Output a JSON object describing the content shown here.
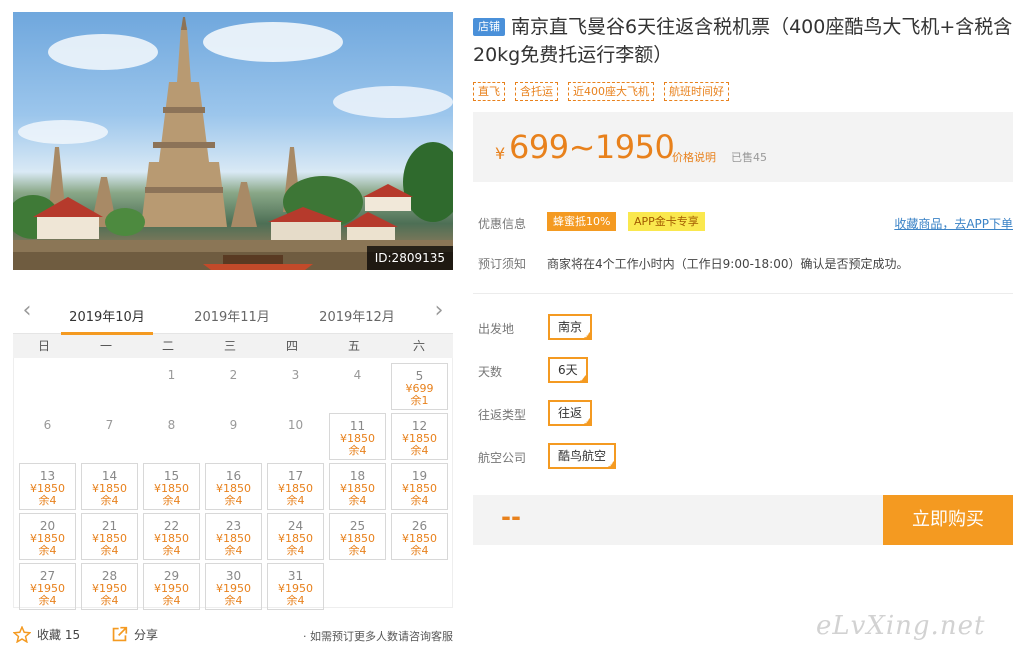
{
  "product": {
    "image_id": "ID:2809135",
    "shop_badge": "店铺",
    "title": "南京直飞曼谷6天往返含税机票（400座酷鸟大飞机+含税含20kg免费托运行李额）",
    "tags": [
      "直飞",
      "含托运",
      "近400座大飞机",
      "航班时间好"
    ]
  },
  "price": {
    "currency": "¥",
    "range": "699~1950",
    "note_link": "价格说明",
    "sold": "已售45"
  },
  "promo": {
    "label": "优惠信息",
    "tag1": "蜂蜜抵10%",
    "tag2": "APP金卡专享",
    "app_link": "收藏商品，去APP下单"
  },
  "booking_notice": {
    "label": "预订须知",
    "text": "商家将在4个工作小时内（工作日9:00-18:00）确认是否预定成功。"
  },
  "options": [
    {
      "label": "出发地",
      "value": "南京"
    },
    {
      "label": "天数",
      "value": "6天"
    },
    {
      "label": "往返类型",
      "value": "往返"
    },
    {
      "label": "航空公司",
      "value": "酷鸟航空"
    }
  ],
  "purchase": {
    "placeholder": "--",
    "buy_label": "立即购买"
  },
  "calendar": {
    "months": [
      "2019年10月",
      "2019年11月",
      "2019年12月"
    ],
    "active_month": "2019年10月",
    "weekdays": [
      "日",
      "一",
      "二",
      "三",
      "四",
      "五",
      "六"
    ],
    "days": [
      {
        "day": "1",
        "price": "",
        "stock": ""
      },
      {
        "day": "2",
        "price": "",
        "stock": ""
      },
      {
        "day": "3",
        "price": "",
        "stock": ""
      },
      {
        "day": "4",
        "price": "",
        "stock": ""
      },
      {
        "day": "5",
        "price": "¥699",
        "stock": "余1"
      },
      {
        "day": "6",
        "price": "",
        "stock": ""
      },
      {
        "day": "7",
        "price": "",
        "stock": ""
      },
      {
        "day": "8",
        "price": "",
        "stock": ""
      },
      {
        "day": "9",
        "price": "",
        "stock": ""
      },
      {
        "day": "10",
        "price": "",
        "stock": ""
      },
      {
        "day": "11",
        "price": "¥1850",
        "stock": "余4"
      },
      {
        "day": "12",
        "price": "¥1850",
        "stock": "余4"
      },
      {
        "day": "13",
        "price": "¥1850",
        "stock": "余4"
      },
      {
        "day": "14",
        "price": "¥1850",
        "stock": "余4"
      },
      {
        "day": "15",
        "price": "¥1850",
        "stock": "余4"
      },
      {
        "day": "16",
        "price": "¥1850",
        "stock": "余4"
      },
      {
        "day": "17",
        "price": "¥1850",
        "stock": "余4"
      },
      {
        "day": "18",
        "price": "¥1850",
        "stock": "余4"
      },
      {
        "day": "19",
        "price": "¥1850",
        "stock": "余4"
      },
      {
        "day": "20",
        "price": "¥1850",
        "stock": "余4"
      },
      {
        "day": "21",
        "price": "¥1850",
        "stock": "余4"
      },
      {
        "day": "22",
        "price": "¥1850",
        "stock": "余4"
      },
      {
        "day": "23",
        "price": "¥1850",
        "stock": "余4"
      },
      {
        "day": "24",
        "price": "¥1850",
        "stock": "余4"
      },
      {
        "day": "25",
        "price": "¥1850",
        "stock": "余4"
      },
      {
        "day": "26",
        "price": "¥1850",
        "stock": "余4"
      },
      {
        "day": "27",
        "price": "¥1950",
        "stock": "余4"
      },
      {
        "day": "28",
        "price": "¥1950",
        "stock": "余4"
      },
      {
        "day": "29",
        "price": "¥1950",
        "stock": "余4"
      },
      {
        "day": "30",
        "price": "¥1950",
        "stock": "余4"
      },
      {
        "day": "31",
        "price": "¥1950",
        "stock": "余4"
      }
    ]
  },
  "footer": {
    "favorite_label": "收藏 15",
    "share_label": "分享",
    "note": "· 如需预订更多人数请咨询客服"
  },
  "watermark": "eLvXing.net",
  "colors": {
    "accent": "#f49a21",
    "price": "#e8811c",
    "link": "#3b83c6",
    "shop_badge": "#4a90d9"
  },
  "icons": [
    "star-icon",
    "share-icon",
    "chevron-left-icon",
    "chevron-right-icon"
  ]
}
